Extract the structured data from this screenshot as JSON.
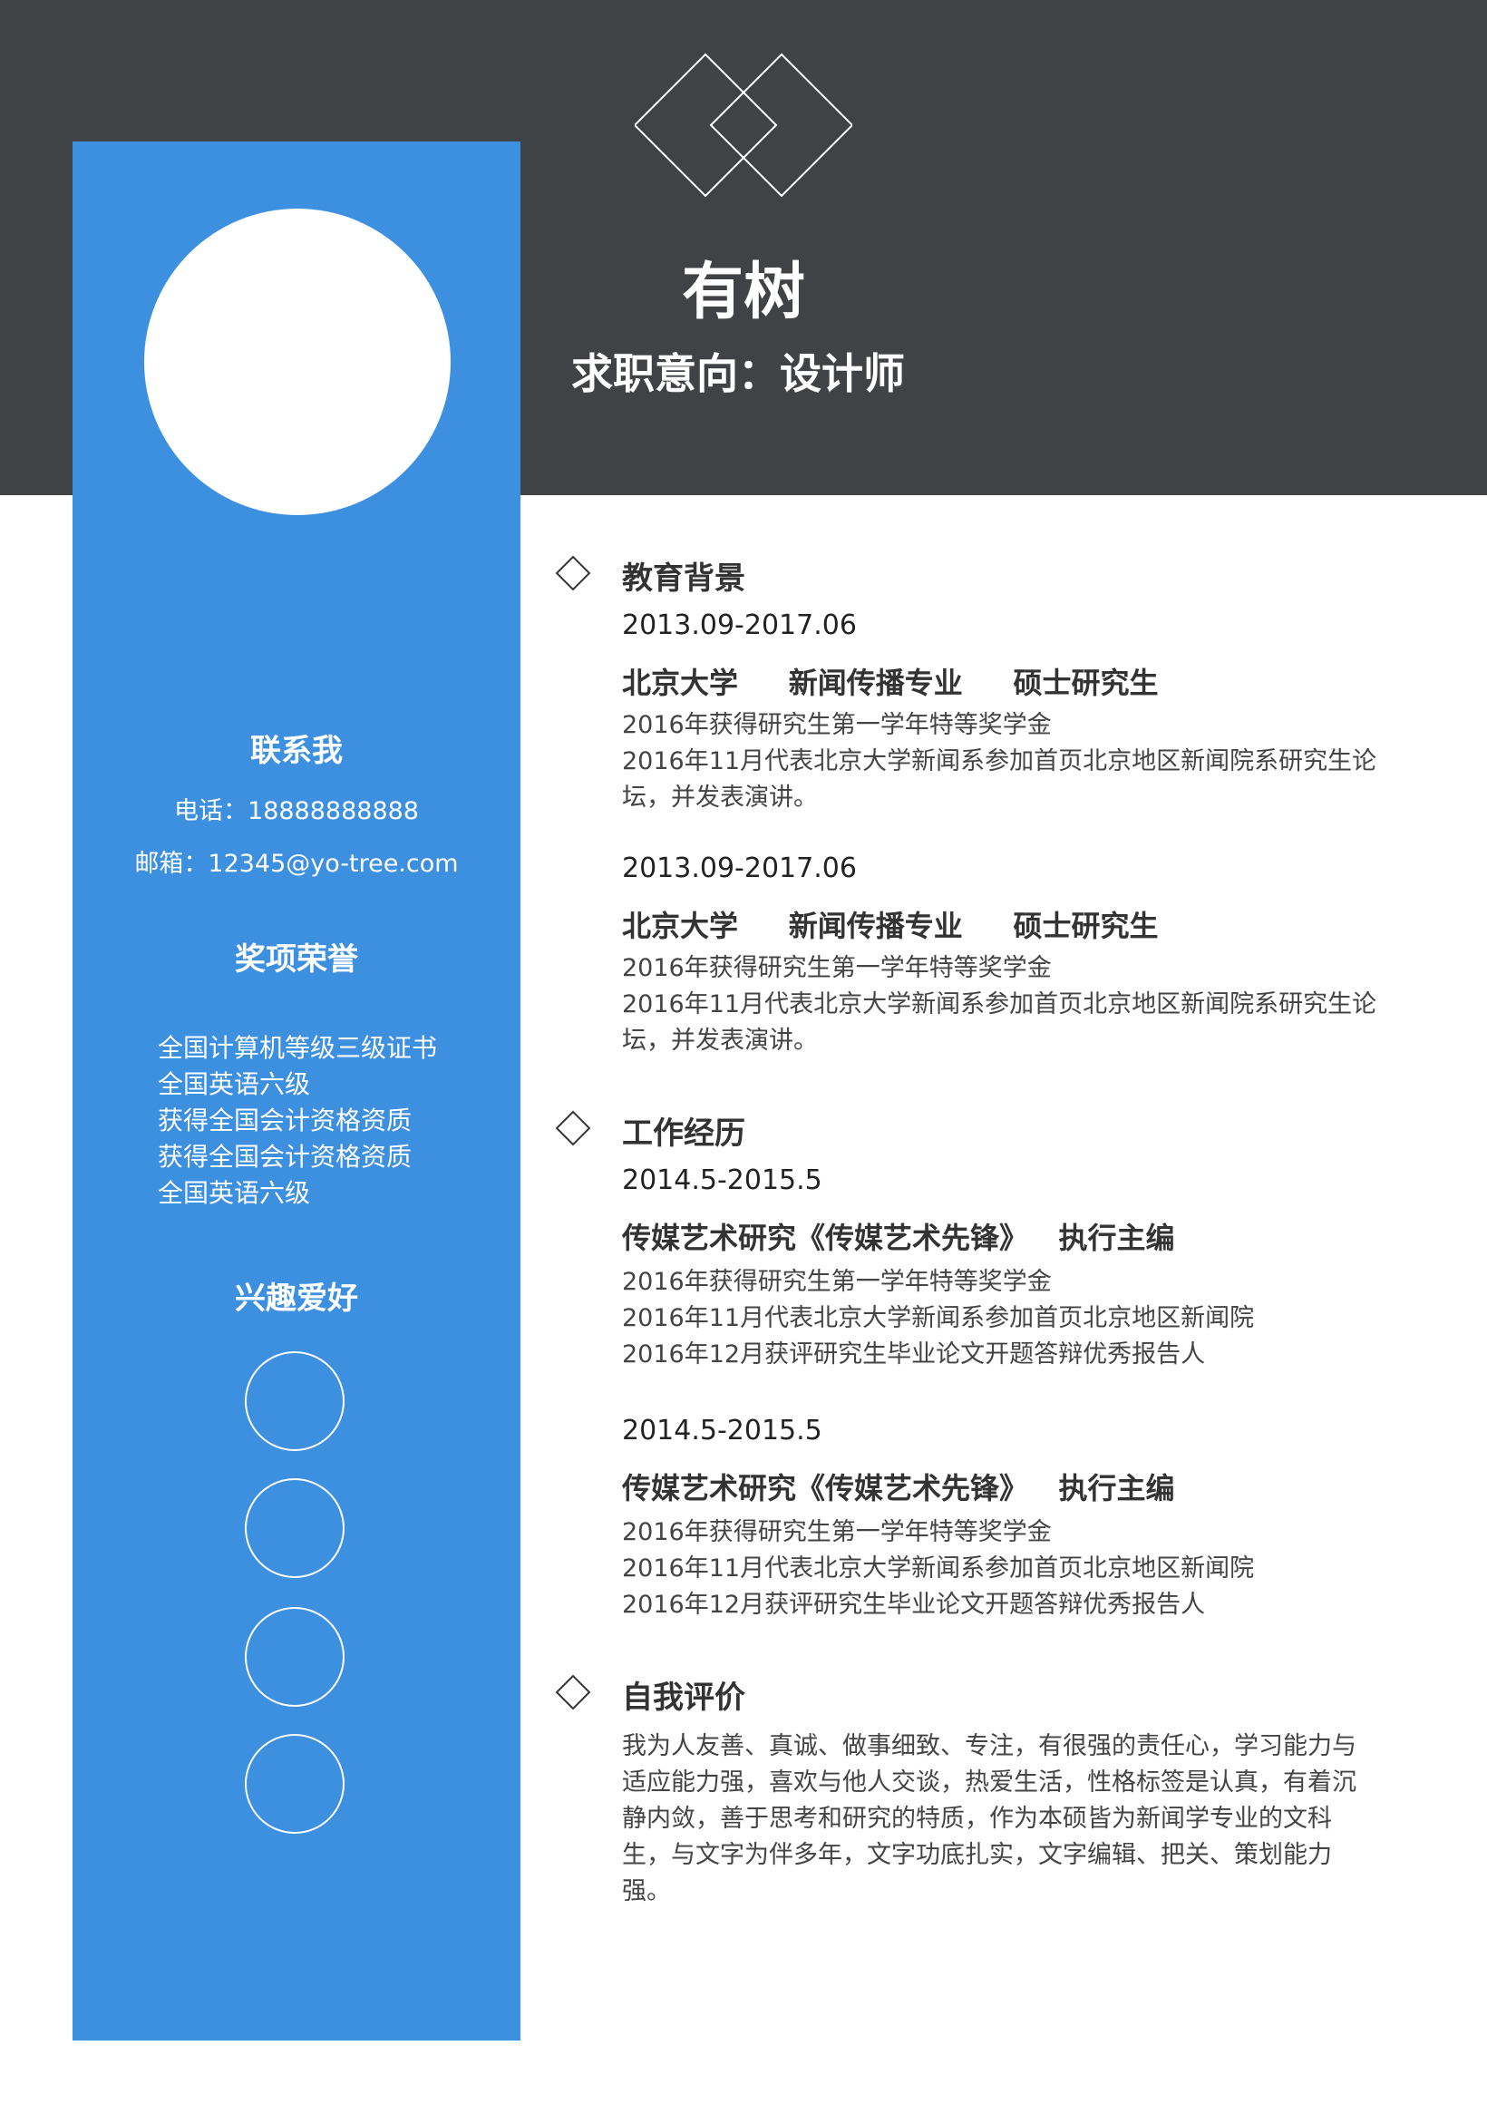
{
  "header": {
    "name": "有树",
    "intent": "求职意向：设计师"
  },
  "sidebar": {
    "contact_title": "联系我",
    "phone": "电话：18888888888",
    "email": "邮箱：12345@yo-tree.com",
    "awards_title": "奖项荣誉",
    "awards": [
      "全国计算机等级三级证书",
      "全国英语六级",
      "获得全国会计资格资质",
      "获得全国会计资格资质",
      "全国英语六级"
    ],
    "hobbies_title": "兴趣爱好"
  },
  "education": {
    "title": "教育背景",
    "entries": [
      {
        "period": "2013.09-2017.06",
        "school": "北京大学",
        "major": "新闻传播专业",
        "degree": "硕士研究生",
        "lines": [
          "2016年获得研究生第一学年特等奖学金",
          "2016年11月代表北京大学新闻系参加首页北京地区新闻院系研究生论",
          "坛，并发表演讲。"
        ]
      },
      {
        "period": "2013.09-2017.06",
        "school": "北京大学",
        "major": "新闻传播专业",
        "degree": "硕士研究生",
        "lines": [
          "2016年获得研究生第一学年特等奖学金",
          "2016年11月代表北京大学新闻系参加首页北京地区新闻院系研究生论",
          "坛，并发表演讲。"
        ]
      }
    ]
  },
  "work": {
    "title": "工作经历",
    "entries": [
      {
        "period": "2014.5-2015.5",
        "company": "传媒艺术研究《传媒艺术先锋》",
        "role": "执行主编",
        "lines": [
          "2016年获得研究生第一学年特等奖学金",
          "2016年11月代表北京大学新闻系参加首页北京地区新闻院",
          "2016年12月获评研究生毕业论文开题答辩优秀报告人"
        ]
      },
      {
        "period": "2014.5-2015.5",
        "company": "传媒艺术研究《传媒艺术先锋》",
        "role": "执行主编",
        "lines": [
          "2016年获得研究生第一学年特等奖学金",
          "2016年11月代表北京大学新闻系参加首页北京地区新闻院",
          "2016年12月获评研究生毕业论文开题答辩优秀报告人"
        ]
      }
    ]
  },
  "self": {
    "title": "自我评价",
    "lines": [
      "我为人友善、真诚、做事细致、专注，有很强的责任心，学习能力与",
      "适应能力强，喜欢与他人交谈，热爱生活，性格标签是认真，有着沉",
      "静内敛，善于思考和研究的特质，作为本硕皆为新闻学专业的文科",
      "生，与文字为伴多年，文字功底扎实，文字编辑、把关、策划能力",
      "强。"
    ]
  },
  "colors": {
    "header_bg": "#414246",
    "sidebar_bg": "#3d8fe0",
    "text": "#333333"
  },
  "icons": {
    "logo": "double-diamond-logo",
    "section_marker": "diamond-outline-icon",
    "hobby": "circle-outline-icon"
  }
}
